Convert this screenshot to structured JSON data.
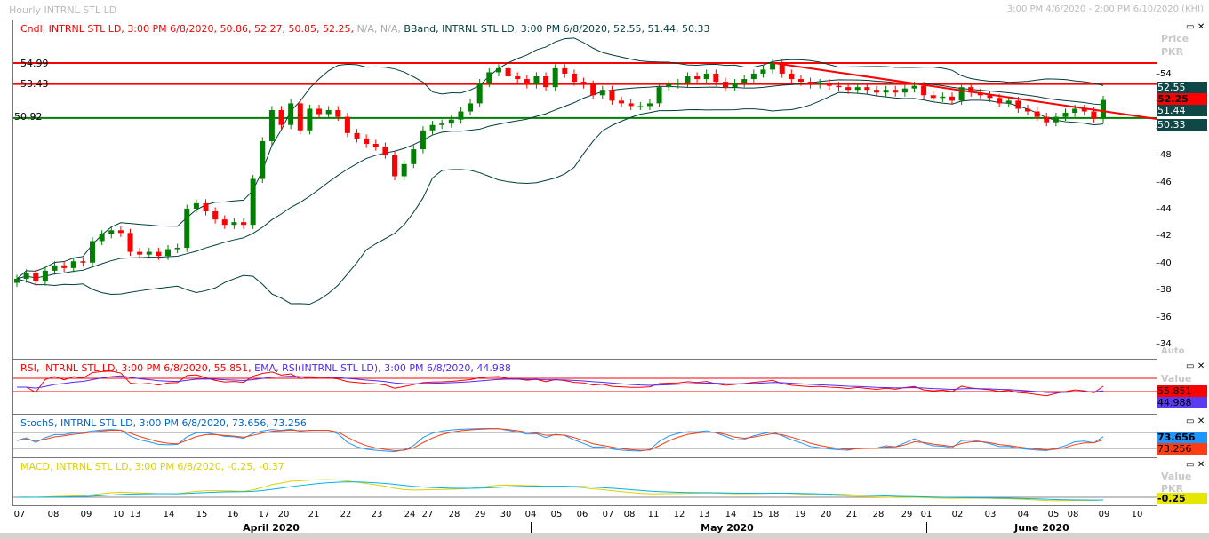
{
  "window": {
    "title": "Hourly INTRNL STL LD",
    "range": "3:00 PM 4/6/2020 - 2:00 PM 6/10/2020 (KHI)"
  },
  "price_pane": {
    "legend_cndl": "Cndl, INTRNL STL LD, 3:00 PM 6/8/2020, 50.86, 52.27, 50.85, 52.25,",
    "legend_na": "N/A, N/A,",
    "legend_bband": "BBand, INTRNL STL LD, 3:00 PM 6/8/2020, 52.55, 51.44, 50.33",
    "axis_title": "Price",
    "axis_unit": "PKR",
    "auto": "Auto",
    "tags": {
      "upper": "52.55",
      "close": "52.25",
      "mid": "51.44",
      "lower": "50.33"
    },
    "level_labels": [
      "54.99",
      "53.43",
      "50.92"
    ]
  },
  "rsi_pane": {
    "legend_a": "RSI, INTRNL STL LD, 3:00 PM 6/8/2020, 55.851,",
    "legend_b": "EMA, RSI(INTRNL STL LD), 3:00 PM 6/8/2020, 44.988",
    "axis_title": "Value",
    "auto": "Auto",
    "tags": [
      "55.851",
      "44.988"
    ]
  },
  "stoch_pane": {
    "legend": "StochS, INTRNL STL LD, 3:00 PM 6/8/2020, 73.656, 73.256",
    "axis_title": "Value",
    "tags": [
      "73.656",
      "73.256"
    ]
  },
  "macd_pane": {
    "legend": "MACD, INTRNL STL LD, 3:00 PM 6/8/2020, -0.25, -0.37",
    "axis_title": "Value",
    "axis_unit": "PKR",
    "tags": [
      "-0.25"
    ]
  },
  "x_axis": {
    "days": [
      "07",
      "08",
      "09",
      "10",
      "13",
      "14",
      "15",
      "16",
      "17",
      "20",
      "21",
      "22",
      "23",
      "24",
      "27",
      "28",
      "29",
      "30",
      "04",
      "05",
      "06",
      "07",
      "08",
      "11",
      "12",
      "13",
      "14",
      "15",
      "18",
      "19",
      "20",
      "21",
      "28",
      "29",
      "01",
      "02",
      "03",
      "04",
      "05",
      "08",
      "09",
      "10"
    ],
    "months": [
      "April 2020",
      "May 2020",
      "June 2020"
    ]
  },
  "colors": {
    "up": "#008000",
    "down": "#ff0000",
    "band": "#003c3c",
    "level_red": "#ff0000",
    "level_green": "#008000"
  },
  "chart_data": {
    "type": "candlestick",
    "title": "Hourly INTRNL STL LD",
    "ylabel": "Price (PKR)",
    "ylim": [
      33,
      57
    ],
    "yticks": [
      34,
      36,
      38,
      40,
      42,
      44,
      46,
      48,
      50,
      52,
      54
    ],
    "closes": [
      39.0,
      39.4,
      38.8,
      39.6,
      40.0,
      39.8,
      40.3,
      40.2,
      41.8,
      42.3,
      42.6,
      42.4,
      41.0,
      40.8,
      41.0,
      40.7,
      41.2,
      41.3,
      44.2,
      44.6,
      44.0,
      43.4,
      43.0,
      43.2,
      43.0,
      46.4,
      49.2,
      51.5,
      50.4,
      52.0,
      50.0,
      51.6,
      51.2,
      51.5,
      51.0,
      49.8,
      49.4,
      49.0,
      48.8,
      48.2,
      46.6,
      47.5,
      48.6,
      50.0,
      50.4,
      50.5,
      50.8,
      51.4,
      52.0,
      53.5,
      54.3,
      54.6,
      54.0,
      53.8,
      53.4,
      54.0,
      53.2,
      54.6,
      54.2,
      53.6,
      53.4,
      52.6,
      53.0,
      52.2,
      52.0,
      51.8,
      51.8,
      52.0,
      53.2,
      53.4,
      53.5,
      54.0,
      53.8,
      54.2,
      53.6,
      53.2,
      53.5,
      53.8,
      54.2,
      54.5,
      55.0,
      54.2,
      53.8,
      53.6,
      53.4,
      53.5,
      53.3,
      53.2,
      53.0,
      53.2,
      53.0,
      52.8,
      53.0,
      52.8,
      53.1,
      53.3,
      52.6,
      52.4,
      52.5,
      52.2,
      53.2,
      52.8,
      52.6,
      52.4,
      52.0,
      52.2,
      51.6,
      51.4,
      51.0,
      50.6,
      51.0,
      51.3,
      51.6,
      51.4,
      50.86,
      52.25
    ],
    "horizontal_levels": [
      {
        "value": 54.99,
        "color": "red"
      },
      {
        "value": 53.43,
        "color": "red"
      },
      {
        "value": 50.92,
        "color": "green"
      }
    ],
    "trendline": {
      "from": {
        "candle": 80,
        "price": 55.0
      },
      "to": {
        "candle": 125,
        "price": 50.4
      }
    },
    "indicators": {
      "bband": {
        "period": 20,
        "last": [
          52.55,
          51.44,
          50.33
        ]
      },
      "rsi": {
        "last": 55.851,
        "ema": 44.988
      },
      "stoch": {
        "last": [
          73.656,
          73.256
        ]
      },
      "macd": {
        "last": [
          -0.25,
          -0.37
        ]
      }
    }
  }
}
